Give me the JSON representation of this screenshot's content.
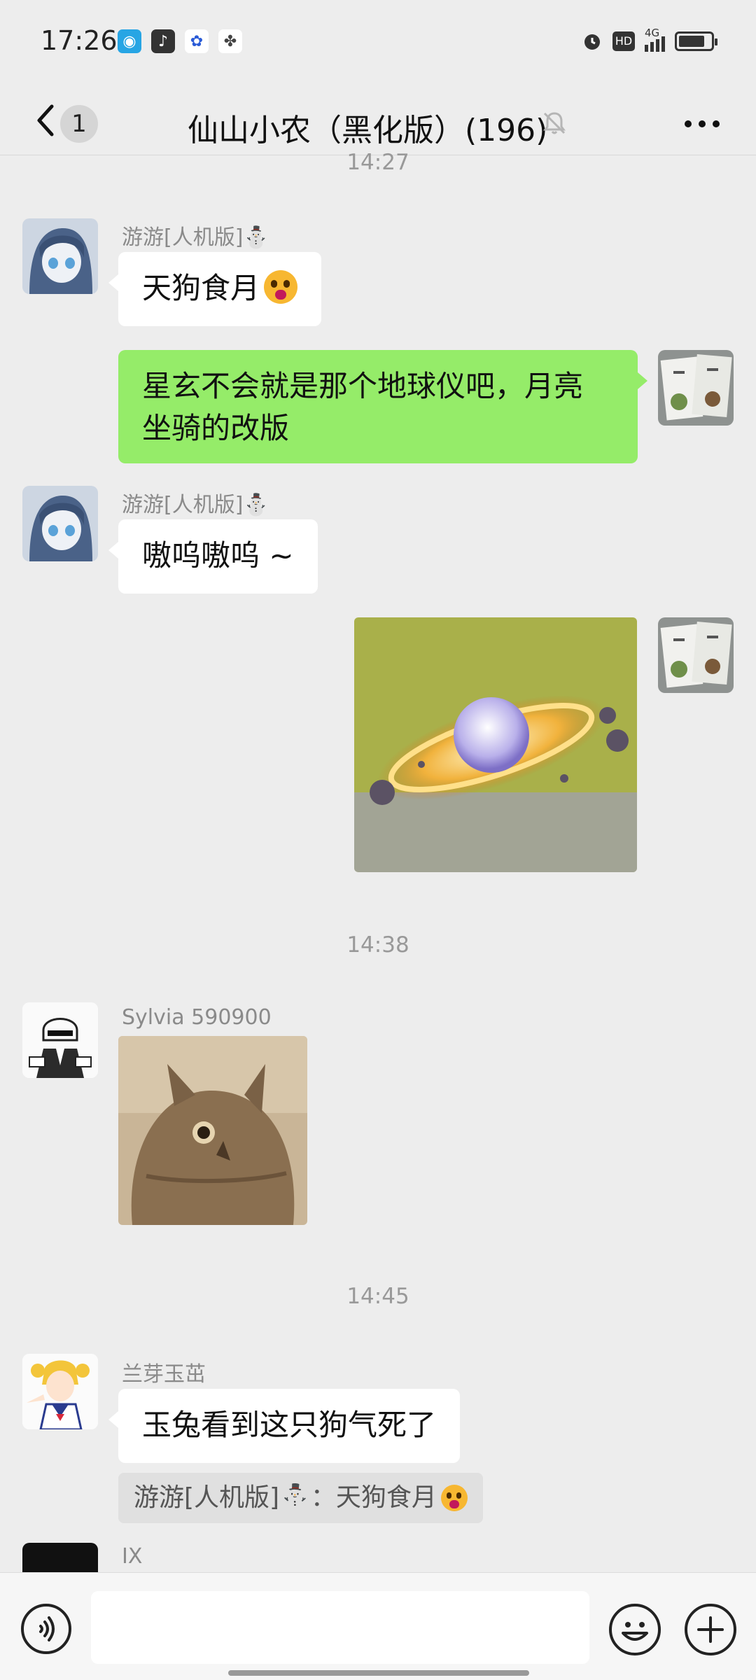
{
  "status_bar": {
    "time": "17:26",
    "network": "4G"
  },
  "header": {
    "back_count": "1",
    "title": "仙山小农（黑化版）(196)"
  },
  "messages": {
    "ts_top": "14:27",
    "m1": {
      "sender": "游游[人机版]⛄",
      "text": "天狗食月"
    },
    "m2": {
      "text_line1": "星玄不会就是那个地球仪吧，月亮",
      "text_line2": "坐骑的改版"
    },
    "m3": {
      "sender": "游游[人机版]⛄",
      "text": "嗷呜嗷呜 ~"
    },
    "ts_1438": "14:38",
    "m5": {
      "sender": "Sylvia 590900"
    },
    "ts_1445": "14:45",
    "m6": {
      "sender": "兰芽玉茁",
      "text": "玉兔看到这只狗气死了",
      "quote": "游游[人机版]⛄：天狗食月"
    },
    "m7": {
      "sender": "IX"
    }
  },
  "input": {
    "placeholder": ""
  },
  "colors": {
    "self_bubble": "#95ec69",
    "background": "#ededed",
    "other_bubble": "#ffffff"
  }
}
